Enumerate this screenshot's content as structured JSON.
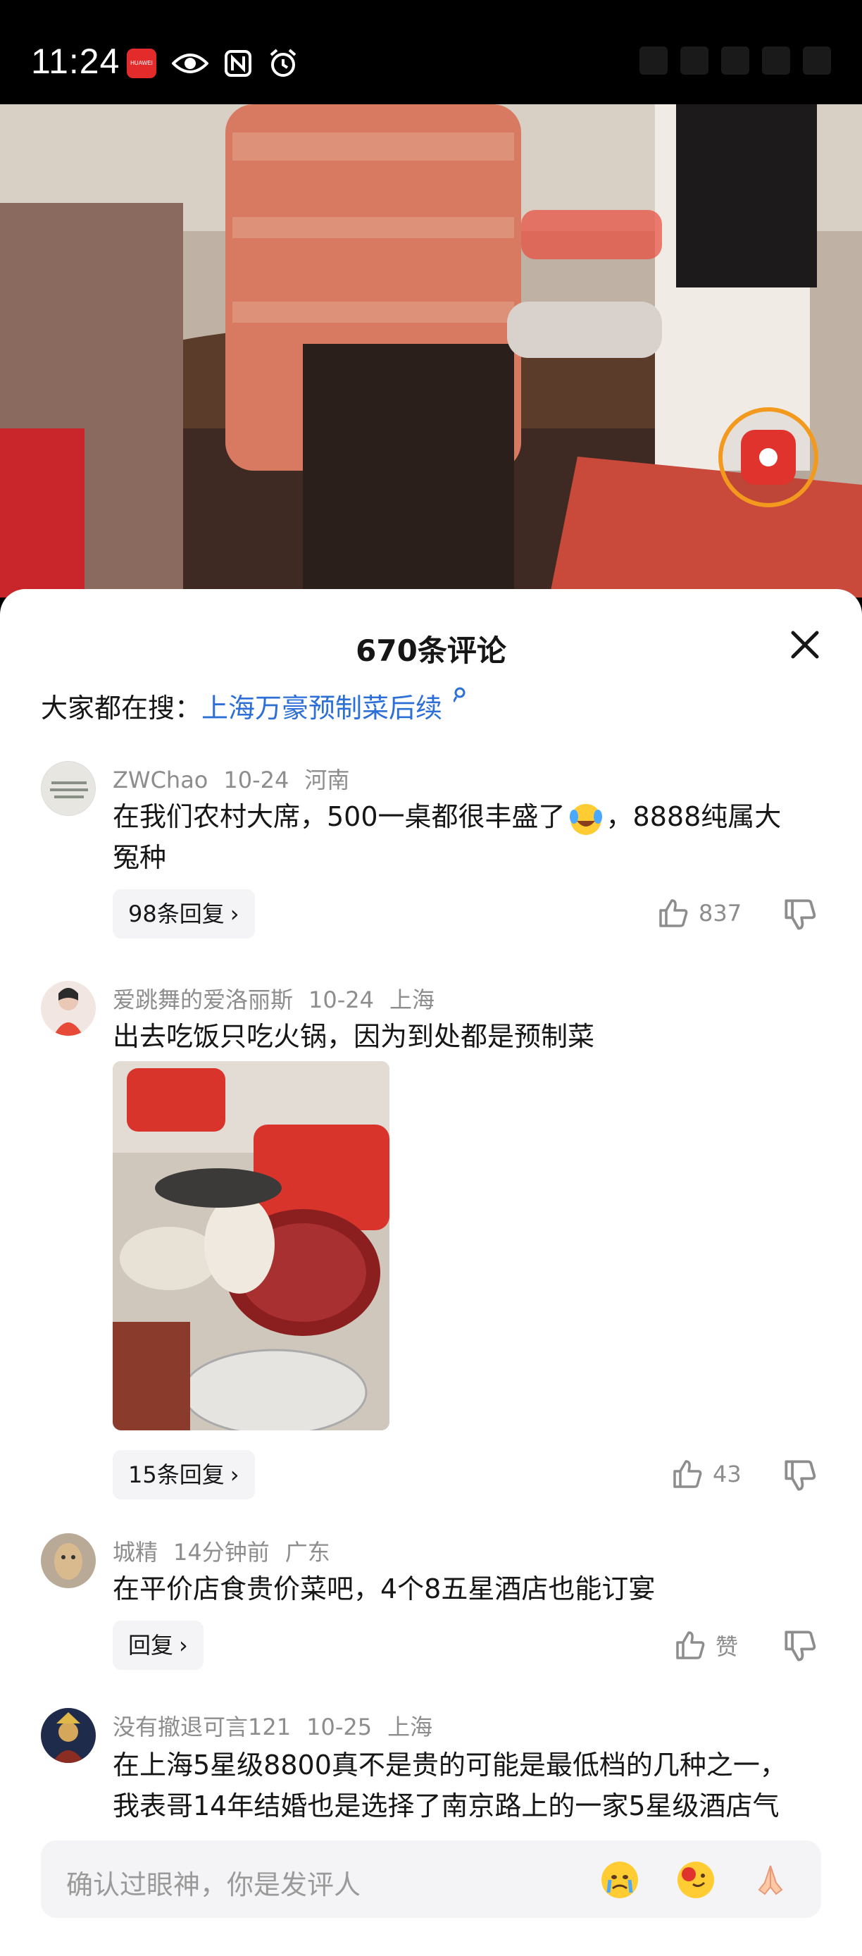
{
  "status_bar": {
    "time": "11:24",
    "carrier_badge": "HUAWEI",
    "icons": [
      "huawei-app-icon",
      "eye-icon",
      "nfc-icon",
      "alarm-icon"
    ]
  },
  "video": {
    "red_button_icon": "red-envelope-icon"
  },
  "sheet": {
    "title": "670条评论",
    "search_prefix": "大家都在搜：",
    "search_link": "上海万豪预制菜后续"
  },
  "comments": [
    {
      "user": "ZWChao",
      "date": "10-24",
      "location": "河南",
      "text_line1": "在我们农村大席，500一桌都很丰盛了",
      "text_line1_tail": "，8888纯属大",
      "text_line2": "冤种",
      "reply_label": "98条回复",
      "likes": "837"
    },
    {
      "user": "爱跳舞的爱洛丽斯",
      "date": "10-24",
      "location": "上海",
      "text_line1": "出去吃饭只吃火锅，因为到处都是预制菜",
      "reply_label": "15条回复",
      "likes": "43"
    },
    {
      "user": "城精",
      "date": "14分钟前",
      "location": "广东",
      "text_line1": "在平价店食贵价菜吧，4个8五星酒店也能订宴",
      "reply_label": "回复",
      "likes": "赞"
    },
    {
      "user": "没有撤退可言121",
      "date": "10-25",
      "location": "上海",
      "text_line1": "在上海5星级8800真不是贵的可能是最低档的几种之一，",
      "text_line2": "我表哥14年结婚也是选择了南京路上的一家5星级酒店气"
    }
  ],
  "input_bar": {
    "placeholder": "确认过眼神，你是发评人",
    "emojis": [
      "crying-face-emoji",
      "rose-face-emoji",
      "praying-hands-emoji"
    ]
  },
  "colors": {
    "link": "#2c6fd6",
    "meta_gray": "#8d8d8d",
    "accent_orange": "#f39a1e",
    "red": "#e0332d"
  }
}
